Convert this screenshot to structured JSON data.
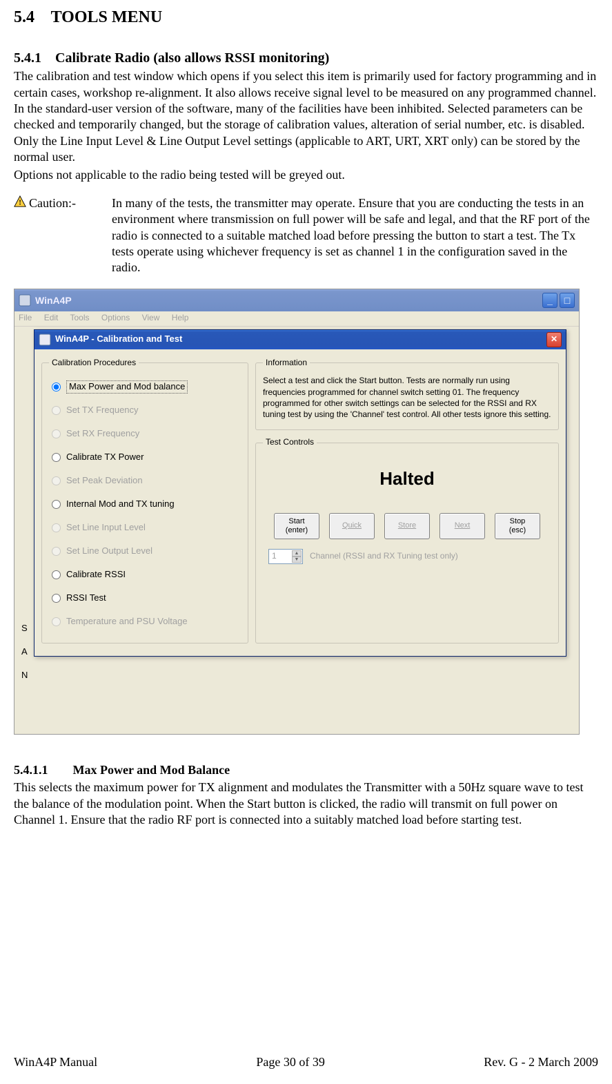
{
  "doc": {
    "section_num": "5.4",
    "section_title": "TOOLS MENU",
    "sub_num": "5.4.1",
    "sub_title": "Calibrate Radio (also allows RSSI monitoring)",
    "para1": "The calibration and test window which opens if you select this item is primarily used for factory programming and in certain cases, workshop re-alignment.  It also allows receive signal level to be measured on any programmed channel.  In the standard-user version of the software, many of the facilities have been inhibited.  Selected parameters can be checked and temporarily changed, but the storage of calibration values, alteration of serial number, etc. is disabled.  Only the Line Input Level & Line Output Level settings (applicable to ART, URT, XRT only) can be stored by the normal user.",
    "para2": "Options not applicable to the radio being tested will be greyed out.",
    "caution_label": "Caution:-",
    "caution_body": "In many of the tests, the transmitter may operate.  Ensure that you are conducting the tests in an environment where transmission on full power will be safe and legal, and that the RF port of the radio is connected to a suitable matched load before pressing the button to start a test.  The Tx tests operate using whichever frequency is set as channel 1 in the configuration saved in the radio.",
    "subsub_num": "5.4.1.1",
    "subsub_title": "Max Power and Mod Balance",
    "subsub_body": "This selects the maximum power for TX alignment and modulates the Transmitter with a 50Hz square wave to test the balance of the modulation point.  When the Start button is clicked, the radio will transmit on full power on Channel 1.  Ensure that the radio RF port is connected into a suitably matched load before starting test."
  },
  "footer": {
    "left": "WinA4P Manual",
    "center": "Page 30 of 39",
    "right": "Rev. G -  2 March 2009"
  },
  "screenshot": {
    "outer_title": "WinA4P",
    "menu": {
      "file": "File",
      "edit": "Edit",
      "tools": "Tools",
      "options": "Options",
      "view": "View",
      "help": "Help"
    },
    "side": {
      "s": "S",
      "a": "A",
      "n": "N"
    },
    "dialog_title": "WinA4P - Calibration and Test",
    "group_cal": "Calibration Procedures",
    "group_info": "Information",
    "group_test": "Test Controls",
    "radios": [
      {
        "label": "Max Power and Mod balance",
        "enabled": true,
        "selected": true,
        "focus": true
      },
      {
        "label": "Set TX Frequency",
        "enabled": false,
        "selected": false
      },
      {
        "label": "Set RX Frequency",
        "enabled": false,
        "selected": false
      },
      {
        "label": "Calibrate TX Power",
        "enabled": true,
        "selected": false
      },
      {
        "label": "Set Peak Deviation",
        "enabled": false,
        "selected": false
      },
      {
        "label": "Internal Mod and TX tuning",
        "enabled": true,
        "selected": false
      },
      {
        "label": "Set Line Input Level",
        "enabled": false,
        "selected": false
      },
      {
        "label": "Set Line Output Level",
        "enabled": false,
        "selected": false
      },
      {
        "label": "Calibrate RSSI",
        "enabled": true,
        "selected": false
      },
      {
        "label": "RSSI Test",
        "enabled": true,
        "selected": false
      },
      {
        "label": "Temperature and PSU Voltage",
        "enabled": false,
        "selected": false
      }
    ],
    "info_text": "Select a test and click the Start button. Tests are normally run using frequencies programmed for channel switch setting 01. The frequency programmed for other switch settings can be selected for the RSSI and RX tuning test by using the 'Channel' test control. All other tests ignore this setting.",
    "status": "Halted",
    "buttons": {
      "start_top": "Start",
      "start_bot": "(enter)",
      "quick": "Quick",
      "store": "Store",
      "next": "Next",
      "stop_top": "Stop",
      "stop_bot": "(esc)"
    },
    "channel_value": "1",
    "channel_label": "Channel (RSSI and RX Tuning test only)"
  }
}
